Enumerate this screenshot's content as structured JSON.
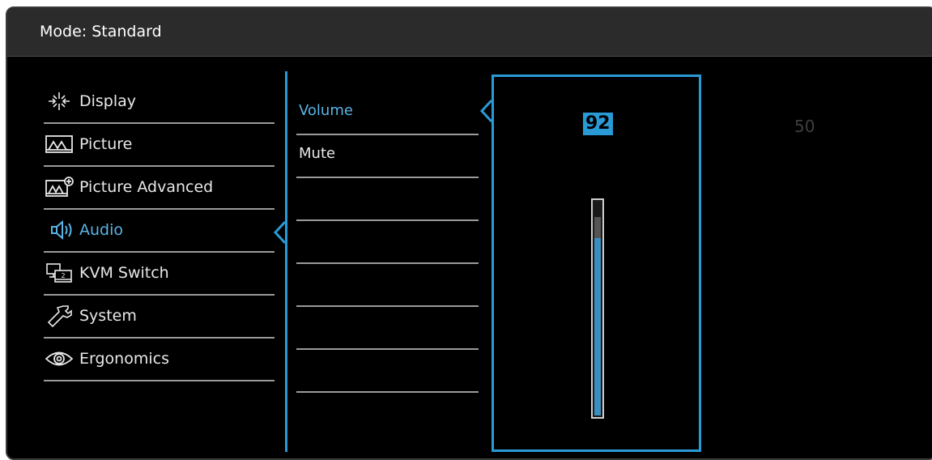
{
  "header": {
    "mode_label": "Mode: Standard"
  },
  "main_menu": {
    "items": [
      {
        "label": "Display",
        "icon": "display-icon"
      },
      {
        "label": "Picture",
        "icon": "picture-icon"
      },
      {
        "label": "Picture Advanced",
        "icon": "picture-advanced-icon"
      },
      {
        "label": "Audio",
        "icon": "audio-speaker-icon",
        "active": true
      },
      {
        "label": "KVM Switch",
        "icon": "kvm-switch-icon"
      },
      {
        "label": "System",
        "icon": "wrench-icon"
      },
      {
        "label": "Ergonomics",
        "icon": "eye-icon"
      }
    ]
  },
  "sub_menu": {
    "items": [
      {
        "label": "Volume",
        "active": true
      },
      {
        "label": "Mute"
      },
      {
        "label": ""
      },
      {
        "label": ""
      },
      {
        "label": ""
      },
      {
        "label": ""
      },
      {
        "label": ""
      }
    ]
  },
  "volume": {
    "value": "92",
    "level_fraction": 0.92,
    "previous_value": "50"
  },
  "colors": {
    "accent": "#2a9ad7",
    "active_text": "#5ab4e6",
    "background": "#000000",
    "titlebar": "#2b2b2b"
  }
}
